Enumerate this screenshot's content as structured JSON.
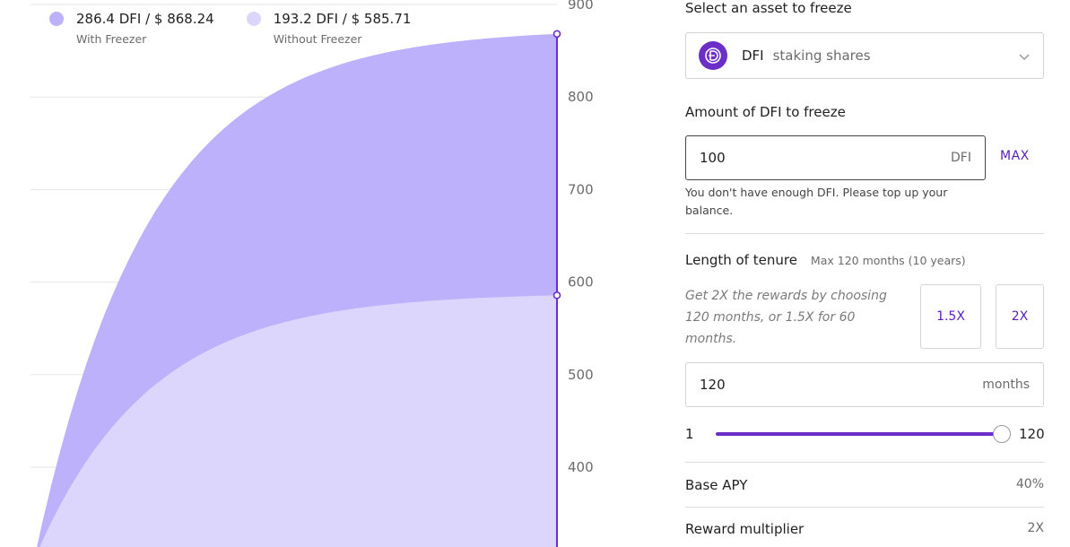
{
  "legend": {
    "with": {
      "value": "286.4 DFI / $ 868.24",
      "label": "With Freezer",
      "color": "#bcb1fa"
    },
    "without": {
      "value": "193.2 DFI / $ 585.71",
      "label": "Without Freezer",
      "color": "#dcd6fc"
    }
  },
  "chart_data": {
    "type": "area",
    "y_ticks": [
      "900",
      "800",
      "700",
      "600",
      "500",
      "400"
    ],
    "ylim": [
      300,
      900
    ],
    "grid": true,
    "series": [
      {
        "name": "With Freezer",
        "color": "#bcb1fa",
        "end_value": 868.24
      },
      {
        "name": "Without Freezer",
        "color": "#dcd6fc",
        "end_value": 585.71
      }
    ],
    "marker_color": "#6b2fc7"
  },
  "form": {
    "asset_label": "Select an asset to freeze",
    "asset": {
      "name": "DFI",
      "desc": "staking shares",
      "icon": "dfi-logo-icon"
    },
    "amount_label": "Amount of DFI to freeze",
    "amount_value": "100",
    "amount_unit": "DFI",
    "max_label": "MAX",
    "error": "You don't have enough DFI. Please top up your balance.",
    "tenure_label": "Length of tenure",
    "tenure_note": "Max 120 months (10 years)",
    "hint": "Get 2X the rewards by choosing 120 months, or 1.5X for 60 months.",
    "multipliers": [
      "1.5X",
      "2X"
    ],
    "months_value": "120",
    "months_unit": "months",
    "slider": {
      "min": "1",
      "max": "120",
      "value": 120
    },
    "base_apy_label": "Base APY",
    "base_apy_value": "40%",
    "reward_label": "Reward multiplier",
    "reward_value": "2X"
  },
  "colors": {
    "accent": "#6b2fc7",
    "link": "#5a1eb3"
  }
}
